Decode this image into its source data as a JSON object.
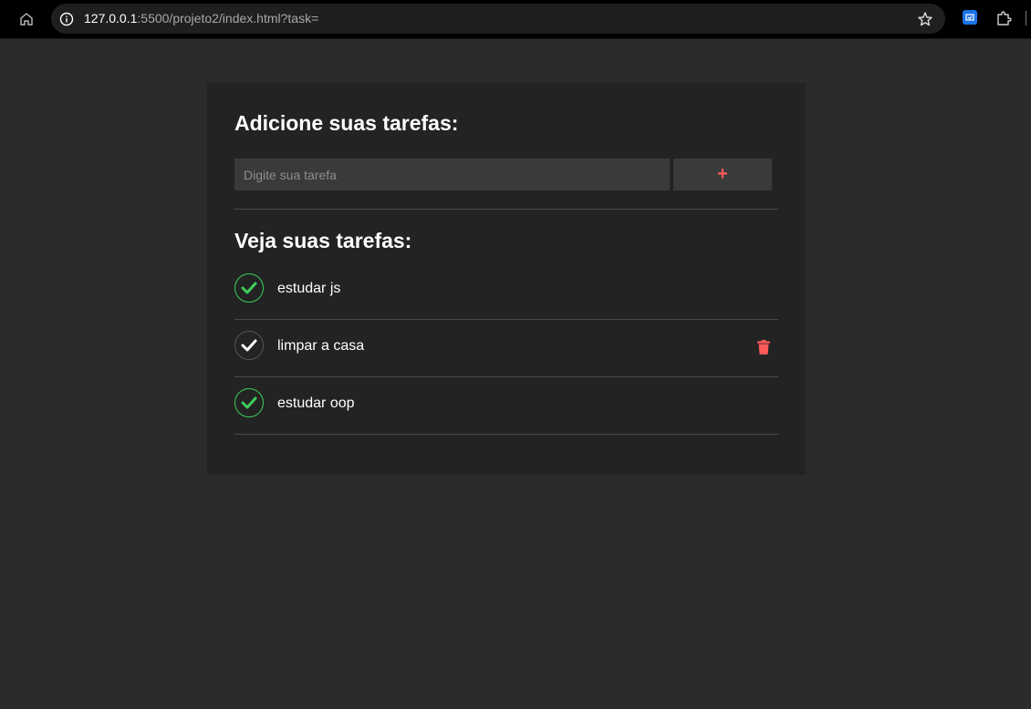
{
  "browser": {
    "url_host": "127.0.0.1",
    "url_path": ":5500/projeto2/index.html?task="
  },
  "app": {
    "add_title": "Adicione suas tarefas:",
    "input_placeholder": "Digite sua tarefa",
    "input_value": "",
    "add_button_label": "+",
    "list_title": "Veja suas tarefas:",
    "tasks": [
      {
        "text": "estudar js",
        "done": true
      },
      {
        "text": "limpar a casa",
        "done": false
      },
      {
        "text": "estudar oop",
        "done": true
      }
    ]
  },
  "colors": {
    "background": "#2b2b2b",
    "card": "#232323",
    "input": "#3a3a3a",
    "accent_red": "#ff5a5a",
    "done_green": "#3ccf5c"
  },
  "icons": [
    "home-icon",
    "info-icon",
    "star-icon",
    "extension-icon",
    "puzzle-icon",
    "check-icon",
    "trash-icon"
  ]
}
